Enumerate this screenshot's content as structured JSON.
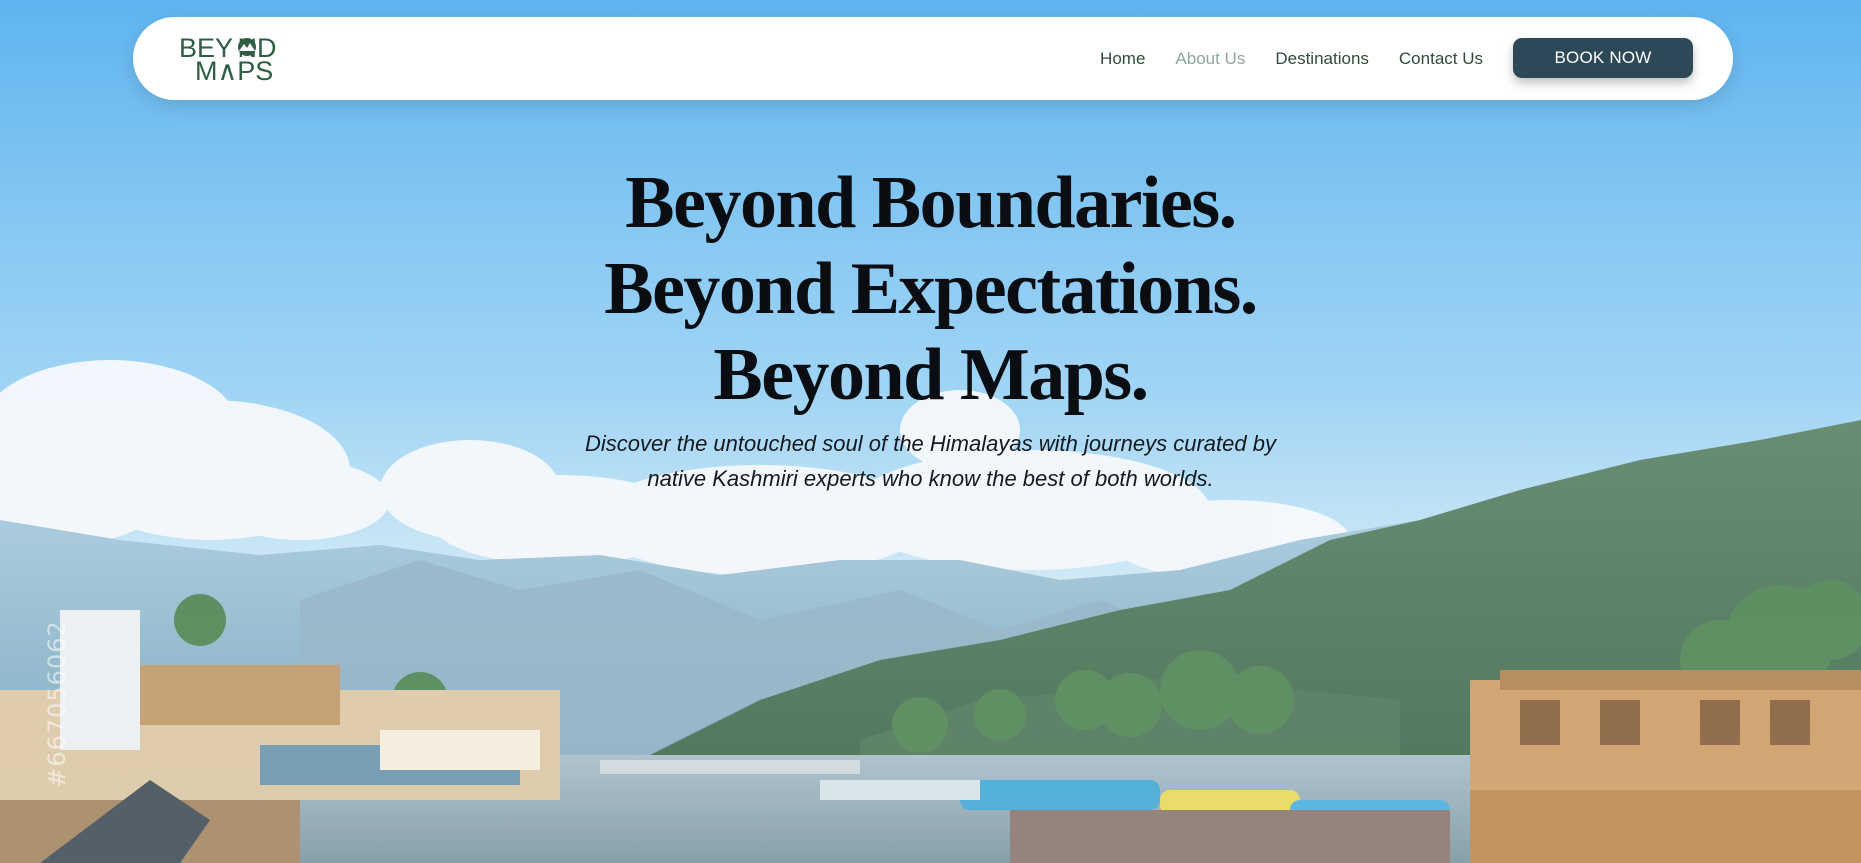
{
  "brand": {
    "logo_line1": "BEY ND",
    "logo_line2": "M∧PS",
    "color": "#2e5e43"
  },
  "nav": {
    "links": [
      {
        "label": "Home",
        "active": false
      },
      {
        "label": "About Us",
        "active": true
      },
      {
        "label": "Destinations",
        "active": false
      },
      {
        "label": "Contact Us",
        "active": false
      }
    ],
    "cta_label": "BOOK NOW",
    "cta_color": "#2d4957"
  },
  "hero": {
    "headline": [
      "Beyond Boundaries.",
      "Beyond Expectations.",
      "Beyond Maps."
    ],
    "subtitle": [
      "Discover the untouched soul of the Himalayas with journeys curated by",
      "native Kashmiri experts who know the best of both worlds."
    ],
    "watermark": "#667056062",
    "sky_color": "#5ab3ee"
  }
}
